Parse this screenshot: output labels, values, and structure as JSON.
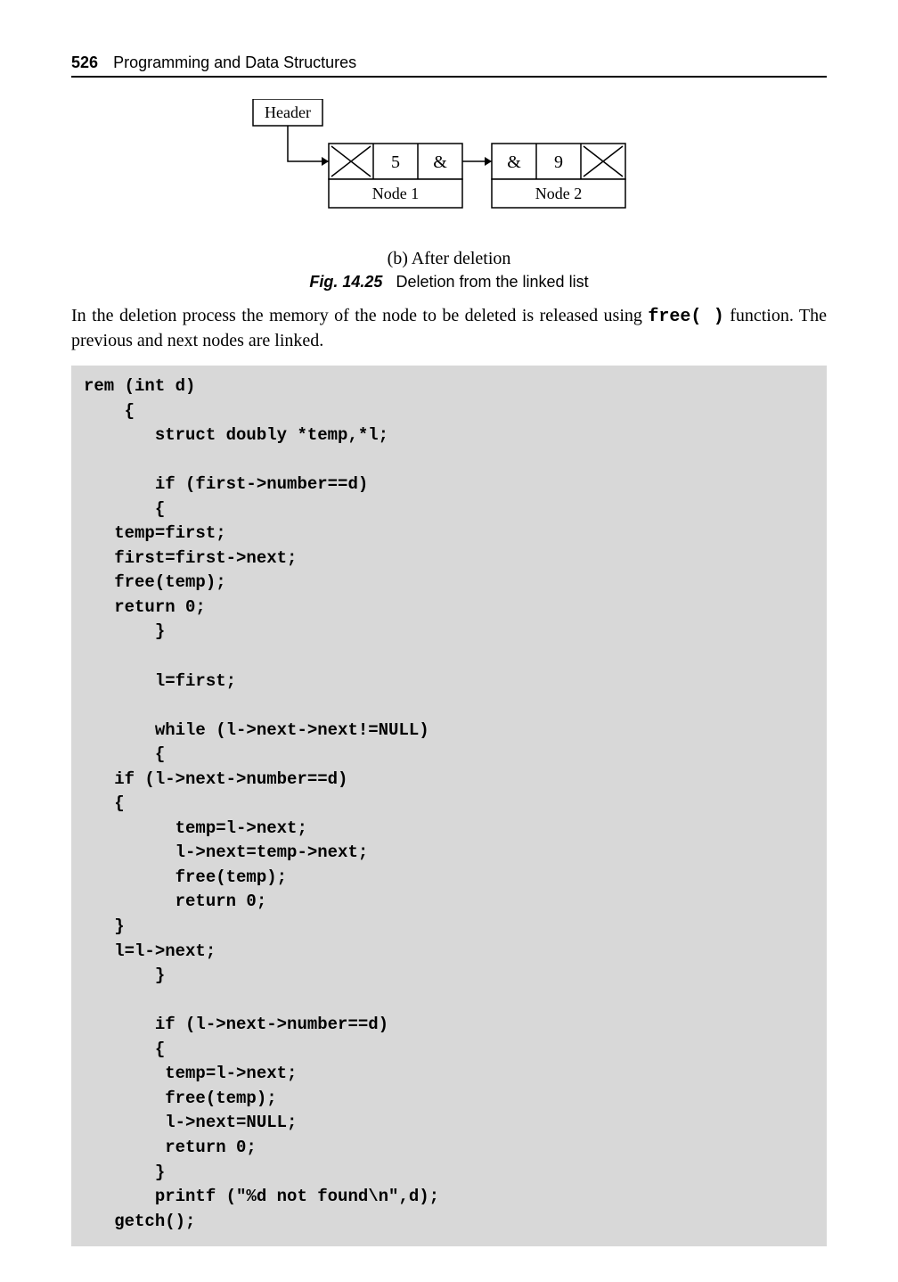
{
  "header": {
    "page_number": "526",
    "title": "Programming and Data Structures"
  },
  "diagram": {
    "header_label": "Header",
    "node1": {
      "value": "5",
      "ptr": "&",
      "label": "Node 1"
    },
    "node2": {
      "value": "9",
      "ptr": "&",
      "label": "Node 2"
    }
  },
  "caption_b": "(b) After deletion",
  "figure": {
    "label": "Fig. 14.25",
    "text": "Deletion from the linked list"
  },
  "paragraph": {
    "pre": "In the deletion process the memory of the node to be deleted is released using ",
    "func": "free( )",
    "post": " function. The previous and next nodes are linked."
  },
  "code": "rem (int d)\n    {\n       struct doubly *temp,*l;\n\n       if (first->number==d)\n       {\n   temp=first;\n   first=first->next;\n   free(temp);\n   return 0;\n       }\n\n       l=first;\n\n       while (l->next->next!=NULL)\n       {\n   if (l->next->number==d)\n   {\n         temp=l->next;\n         l->next=temp->next;\n         free(temp);\n         return 0;\n   }\n   l=l->next;\n       }\n\n       if (l->next->number==d)\n       {\n        temp=l->next;\n        free(temp);\n        l->next=NULL;\n        return 0;\n       }\n       printf (\"%d not found\\n\",d);\n   getch();"
}
